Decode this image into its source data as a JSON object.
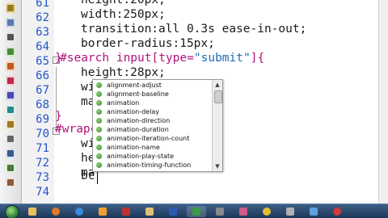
{
  "editor": {
    "line_numbers": [
      "61",
      "62",
      "63",
      "64",
      "65",
      "66",
      "67",
      "68",
      "69",
      "70",
      "71",
      "72",
      "73",
      "74"
    ],
    "lines": [
      {
        "text": "height:20px;"
      },
      {
        "text": "width:250px;"
      },
      {
        "text": "transition:all 0.3s ease-in-out;"
      },
      {
        "text": "border-radius:15px;"
      },
      {
        "text": "}"
      },
      {
        "pre": "#search input[type=",
        "str": "\"submit\"",
        "post": "]{"
      },
      {
        "text": "height:28px;"
      },
      {
        "text": "wi"
      },
      {
        "text": "ma"
      },
      {
        "text": "}"
      },
      {
        "text": "#wrapc"
      },
      {
        "text": "wi"
      },
      {
        "text": "he"
      },
      {
        "text": "ma"
      },
      {
        "text": "bc"
      }
    ],
    "fold_markers": [
      "-",
      "-"
    ]
  },
  "autocomplete": {
    "items": [
      "alignment-adjust",
      "alignment-baseline",
      "animation",
      "animation-delay",
      "animation-direction",
      "animation-duration",
      "animation-iteration-count",
      "animation-name",
      "animation-play-state",
      "animation-timing-function"
    ],
    "scroll_up": "▲",
    "scroll_down": "▼"
  },
  "toolbar": {
    "icons": [
      "wand-icon",
      "box-icon",
      "cursor-icon",
      "grid-icon",
      "brush-icon",
      "palette-icon",
      "layout-icon",
      "css-icon",
      "tag-icon",
      "undo-icon",
      "list-icon",
      "indent-icon",
      "outdent-icon"
    ]
  },
  "taskbar": {
    "apps": [
      "explorer-icon",
      "firefox-icon",
      "ie-icon",
      "media-icon",
      "app-icon",
      "folder-icon",
      "word-icon",
      "dreamweaver-icon",
      "calc-icon",
      "paint-icon",
      "chrome-icon",
      "settings-icon",
      "network-icon",
      "recorder-icon"
    ]
  },
  "colors": {
    "selector": "#b2127a",
    "string": "#1a6eb8",
    "line_number": "#2255cc",
    "taskbar": "#2a4a72"
  }
}
